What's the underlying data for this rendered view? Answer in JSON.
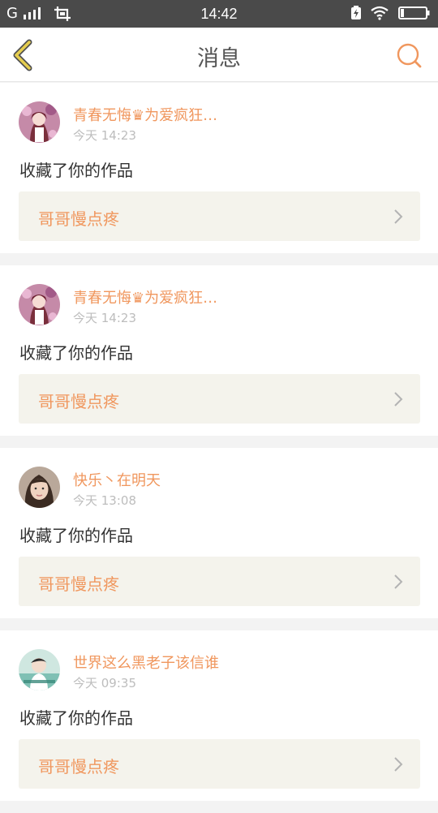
{
  "status_bar": {
    "signal_text": "G",
    "time": "14:42",
    "icons": [
      "signal-icon",
      "screenshot-icon",
      "charging-icon",
      "wifi-icon",
      "battery-icon"
    ]
  },
  "header": {
    "title": "消息",
    "back_icon": "back-chevron-icon",
    "search_icon": "search-icon"
  },
  "colors": {
    "accent": "#f0975e",
    "back_icon_color": "#d4b93b",
    "work_box_bg": "#f4f3ec"
  },
  "messages": [
    {
      "user": "青春无悔♛为爱疯狂…",
      "time": "今天 14:23",
      "action": "收藏了你的作品",
      "work_title": "哥哥慢点疼",
      "avatar": "anime-girl-avatar"
    },
    {
      "user": "青春无悔♛为爱疯狂…",
      "time": "今天 14:23",
      "action": "收藏了你的作品",
      "work_title": "哥哥慢点疼",
      "avatar": "anime-girl-avatar"
    },
    {
      "user": "快乐丶在明天",
      "time": "今天 13:08",
      "action": "收藏了你的作品",
      "work_title": "哥哥慢点疼",
      "avatar": "photo-woman-avatar"
    },
    {
      "user": "世界这么黑老子该信谁",
      "time": "今天 09:35",
      "action": "收藏了你的作品",
      "work_title": "哥哥慢点疼",
      "avatar": "photo-boy-avatar"
    }
  ]
}
